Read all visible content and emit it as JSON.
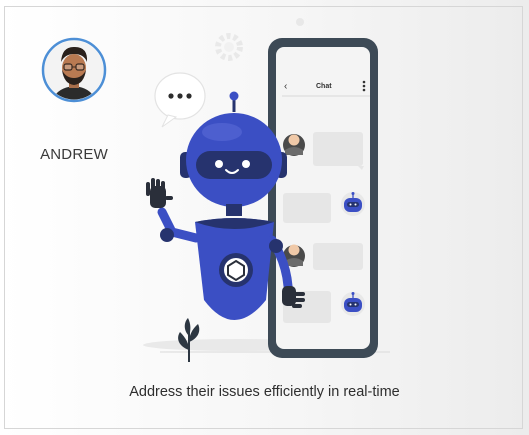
{
  "user": {
    "name": "ANDREW"
  },
  "caption": "Address their issues efficiently in real-time",
  "phone": {
    "header_title": "Chat",
    "back_glyph": "‹",
    "menu_glyph": "⋮"
  },
  "colors": {
    "robot_blue": "#3b4fc4",
    "robot_dark": "#26336e",
    "phone_frame": "#3d4a56",
    "bubble_gray": "#e6e6e6",
    "avatar_ring": "#4d8fd6"
  },
  "icons": {
    "typing_bubble": "speech-bubble-dots-icon",
    "plant": "plant-icon",
    "gear": "gear-icon"
  }
}
